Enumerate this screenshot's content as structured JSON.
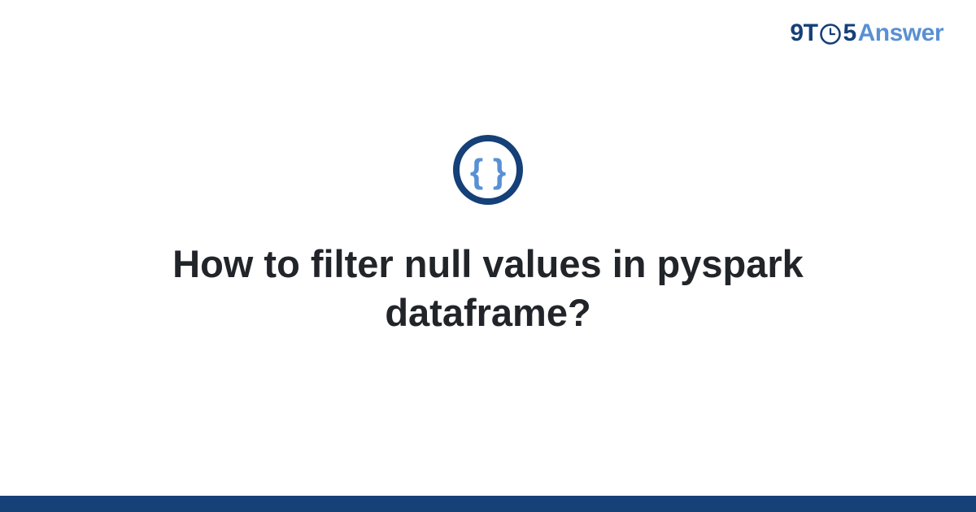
{
  "brand": {
    "prefix": "9T",
    "suffix": "5",
    "word": "Answer"
  },
  "main": {
    "title": "How to filter null values in pyspark dataframe?"
  },
  "colors": {
    "dark_blue": "#154078",
    "light_blue": "#5990d4",
    "text": "#212529"
  }
}
